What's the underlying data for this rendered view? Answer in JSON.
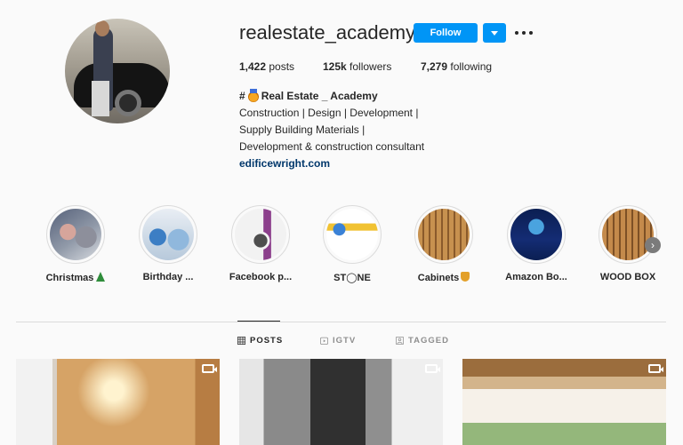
{
  "profile": {
    "username": "realestate_academy",
    "follow_label": "Follow",
    "more_label": "Options"
  },
  "stats": {
    "posts": "1,422",
    "posts_label": "posts",
    "followers": "125k",
    "followers_label": "followers",
    "following": "7,279",
    "following_label": "following"
  },
  "bio": {
    "name_prefix": "#",
    "name": "Real Estate _ Academy",
    "line1": "Construction | Design | Development |",
    "line2": "Supply Building Materials |",
    "line3": "Development & construction consultant",
    "link": "edificewright.com"
  },
  "stories": [
    {
      "label": "Christmas"
    },
    {
      "label": "Birthday ..."
    },
    {
      "label": "Facebook p..."
    },
    {
      "label": "ST◯NE"
    },
    {
      "label": "Cabinets"
    },
    {
      "label": "Amazon Bo..."
    },
    {
      "label": "WOOD BOX"
    }
  ],
  "tabs": {
    "posts": "POSTS",
    "igtv": "IGTV",
    "tagged": "TAGGED"
  },
  "colors": {
    "accent": "#0095f6",
    "link": "#00376b",
    "background": "#fafafa",
    "divider": "#dbdbdb"
  },
  "icons": [
    "more-icon",
    "chevron-down-icon",
    "grid-icon",
    "igtv-icon",
    "tag-icon",
    "video-icon",
    "chevron-right-icon"
  ]
}
